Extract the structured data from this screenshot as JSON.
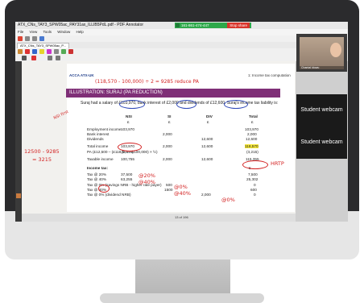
{
  "window": {
    "title": "ATX_CNs_TAY3_SPW05ac_PAY31ax_ILLIB5PdL.pdf - PDF Annotator",
    "menu": [
      "File",
      "View",
      "Tools",
      "Window",
      "Help"
    ],
    "tab_label": "ATX_CNs_TAY3_SPW05ac_P...",
    "bottom_page_indicator": "13 of 196"
  },
  "zoom": {
    "meeting_id": "161-861-474-447",
    "stop_share_label": "Stop share"
  },
  "slide": {
    "header_left": "ACCA ATX-UK",
    "header_right": "1: Income tax computation",
    "band_title": "ILLUSTRATION: SURAJ (PA REDUCTION)",
    "intro": "Suraj had a salary of £103,970, bank interest of £2,000 and dividends of £12,600. Suraj's income tax liability is:",
    "col_headers": [
      "NSI",
      "SI",
      "DIV",
      "Total"
    ],
    "col_units": [
      "£",
      "£",
      "£",
      "£"
    ],
    "rows": [
      {
        "label": "Employment income",
        "nsi": "103,970",
        "si": "",
        "div": "",
        "total": "103,970"
      },
      {
        "label": "Bank interest",
        "nsi": "",
        "si": "2,000",
        "div": "",
        "total": "2,000"
      },
      {
        "label": "Dividends",
        "nsi": "",
        "si": "",
        "div": "12,600",
        "total": "12,600"
      },
      {
        "label": "Total income",
        "nsi": "103,970",
        "si": "2,000",
        "div": "12,600",
        "total": "118,570"
      },
      {
        "label": "PA (£12,500 – (£118,570 - £100,000) × ½)",
        "nsi": "(9,215)",
        "si": "",
        "div": "",
        "total": "(3,215)"
      },
      {
        "label": "Taxable income",
        "nsi": "100,755",
        "si": "2,000",
        "div": "12,600",
        "total": "115,355"
      }
    ],
    "tax_heading": "Income tax:",
    "tax_rows": [
      {
        "label": "Tax @ 20%",
        "base": "37,500",
        "total": "7,500"
      },
      {
        "label": "Tax @ 40%",
        "base": "63,255",
        "total": "25,302"
      },
      {
        "label": "Tax @ 0% (savings NRB - higher rate payer)",
        "base": "500",
        "total": "0"
      },
      {
        "label": "Tax @ 40%",
        "base": "1500",
        "total": "600"
      },
      {
        "label": "Tax @ 0% (dividend NRB)",
        "base": "2,000",
        "total": "0"
      }
    ],
    "tax_unit": "£"
  },
  "annotations": {
    "top_formula": "(118,570 - 100,000) ÷ 2 = 9285 reduce PA",
    "left_pa": "12500 - 9285",
    "left_result": "= 3215",
    "side_note": "HRTP",
    "margin_note": "NSI first",
    "at20": "@20%",
    "at40": "@40%",
    "at0": "@0%",
    "at40b": "@40%",
    "at0b": "@0%"
  },
  "participants": {
    "speaker_name": "Chantal Idowu",
    "tiles": [
      "Student webcam",
      "Student webcam"
    ]
  },
  "colors": {
    "band": "#7f2f77",
    "ink_red": "#d32222",
    "ink_blue": "#2f49b8",
    "highlight": "#f7e93a",
    "zoom_green": "#2ea84a",
    "stop_red": "#d9342b"
  }
}
